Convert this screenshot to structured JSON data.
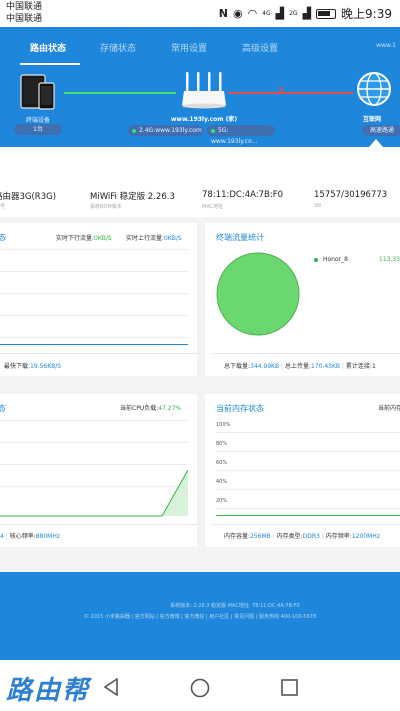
{
  "status_bar": {
    "carrier_1": "中国联通",
    "carrier_2": "中国联通",
    "time": "晚上9:39",
    "signal_1": "4G",
    "signal_2": "2G"
  },
  "nav": {
    "tabs": [
      {
        "label": "路由状态",
        "active": true
      },
      {
        "label": "存储状态"
      },
      {
        "label": "常用设置"
      },
      {
        "label": "高级设置"
      }
    ],
    "url_fragment": "www.1"
  },
  "topology": {
    "devices_label": "终端设备",
    "devices_count": "1台",
    "router_name": "www.193ly.com (家)",
    "wifi_24": "2.4G:www.193ly.com",
    "wifi_5": "5G: www.193ly.co...",
    "internet_label": "互联网",
    "internet_status": "高速路通"
  },
  "info": {
    "items": [
      {
        "value": "路由器3G(R3G)",
        "sub": "号"
      },
      {
        "value": "MiWiFi 稳定版 2.26.3",
        "sub": "系统ROM版本"
      },
      {
        "value": "78:11:DC:4A:7B:F0",
        "sub": "MAC地址"
      },
      {
        "value": "15757/30196773",
        "sub": "SN"
      }
    ]
  },
  "traffic_card": {
    "title": "态",
    "down_label": "实时下行流量:",
    "down_value": "0KB/S",
    "up_label": "实时上行流量:",
    "up_value": "0KB/S",
    "peak_label": "最快下载:",
    "peak_value": "19.56KB/S"
  },
  "terminal_card": {
    "title": "终端流量统计",
    "device_name": "Honor_8",
    "device_value": "113.33",
    "total_down_label": "总下载量:",
    "total_down_value": "344.99KB",
    "total_up_label": "总上传量:",
    "total_up_value": "170.43KB",
    "total_conn_label": "累计连接:",
    "total_conn_value": "1"
  },
  "cpu_card": {
    "title": "态",
    "load_label": "当前CPU负载:",
    "load_value": "47.27%",
    "cores": "4",
    "freq_label": "核心频率:",
    "freq_value": "880MHz"
  },
  "mem_card": {
    "title": "当前内存状态",
    "load_label": "当前内存",
    "y_labels": [
      "100%",
      "80%",
      "60%",
      "40%",
      "20%"
    ],
    "cap_label": "内存容量:",
    "cap_value": "256MB",
    "type_label": "内存类型:",
    "type_value": "DDR3",
    "freq_label": "内存频率:",
    "freq_value": "1200MHz"
  },
  "footer": {
    "version": "系统版本: 2.26.3 稳定版  MAC地址: 78:11:DC:4A:7B:F0",
    "links": "© 2015 小米路由器  |  官方网站  |  官方微博  |  官方微信  |  用户社区  |  常见问题  |  服务热线 400-100-5678"
  },
  "android_nav": {
    "watermark": "路由帮"
  },
  "colors": {
    "primary": "#1e87dc",
    "green": "#35b24a",
    "pie": "#6bd86f",
    "link_ok": "#3de16d",
    "link_fail": "#e34d4d"
  },
  "chart_data": [
    {
      "type": "area",
      "title": "态",
      "note": "traffic chart, flat at zero",
      "values": [
        0,
        0,
        0,
        0,
        0,
        0,
        0,
        0,
        0,
        0,
        0
      ],
      "ylim": [
        0,
        100
      ]
    },
    {
      "type": "pie",
      "title": "终端流量统计",
      "categories": [
        "Honor_8"
      ],
      "values": [
        113.33
      ]
    },
    {
      "type": "area",
      "title": "态",
      "note": "CPU load",
      "values": [
        0,
        0,
        0,
        0,
        0,
        0,
        0,
        0,
        0,
        0,
        47.27
      ],
      "ylim": [
        0,
        100
      ]
    },
    {
      "type": "area",
      "title": "当前内存状态",
      "y_labels": [
        "100%",
        "80%",
        "60%",
        "40%",
        "20%"
      ],
      "values": [],
      "ylim": [
        0,
        100
      ]
    }
  ]
}
